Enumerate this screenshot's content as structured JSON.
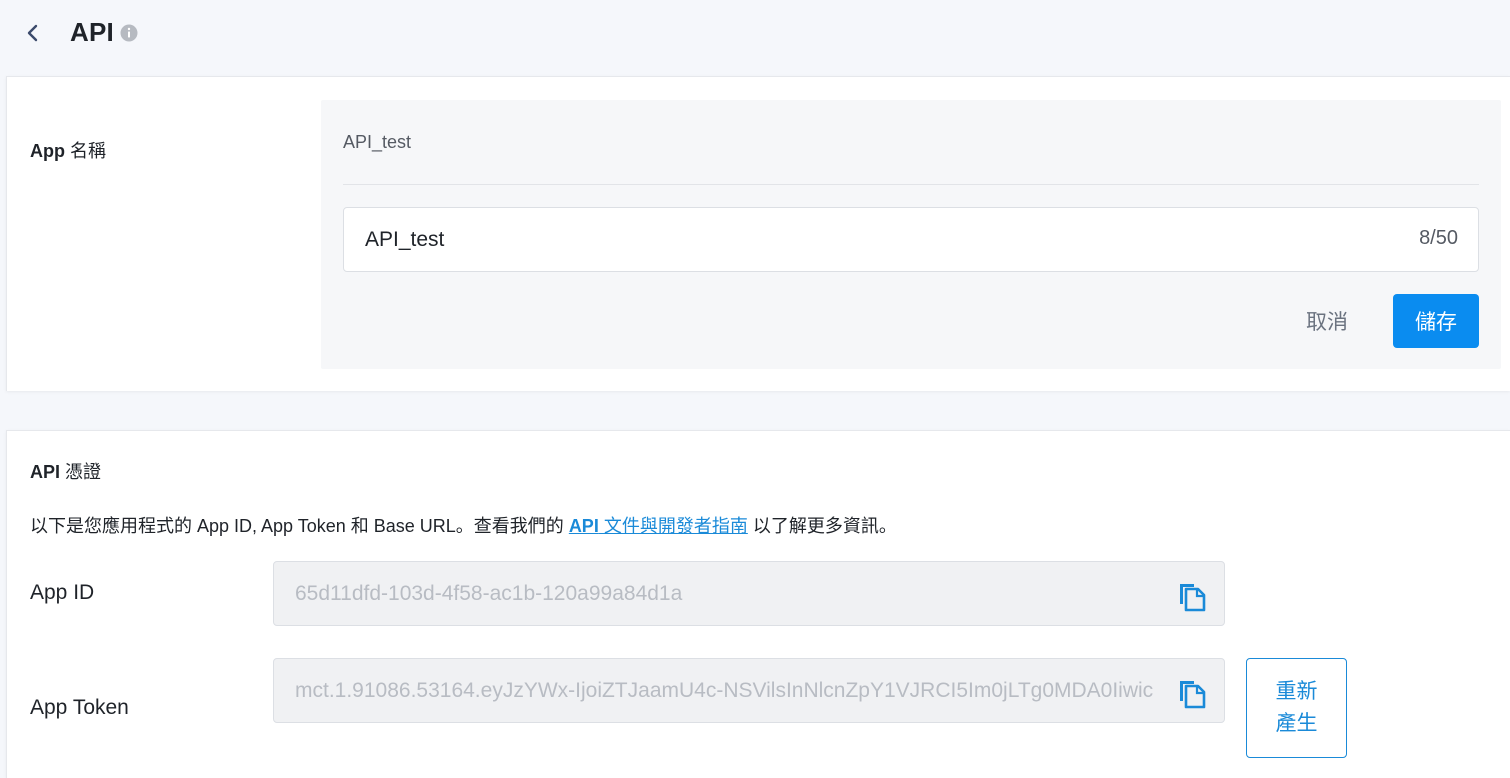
{
  "header": {
    "title": "API",
    "back_icon": "chevron-left-icon",
    "info_icon": "info-icon"
  },
  "app_name": {
    "label_prefix": "App",
    "label_suffix": "名稱",
    "current_value": "API_test",
    "input_value": "API_test",
    "char_count": "8/50",
    "cancel_label": "取消",
    "save_label": "儲存"
  },
  "credentials": {
    "title_prefix": "API",
    "title_suffix": "憑證",
    "desc_before": "以下是您應用程式的 App ID, App Token 和 Base URL。查看我們的 ",
    "link_prefix": "API",
    "link_suffix": " 文件與開發者指南",
    "desc_after": " 以了解更多資訊。",
    "app_id_label": "App ID",
    "app_id_value": "65d11dfd-103d-4f58-ac1b-120a99a84d1a",
    "app_token_label": "App Token",
    "app_token_value": "mct.1.91086.53164.eyJzYWx-IjoiZTJaamU4c-NSVilsInNlcnZpY1VJRCI5Im0jLTg0MDA0Iiwic",
    "regen_line1": "重新",
    "regen_line2": "產生"
  },
  "colors": {
    "accent": "#0a8cf0",
    "link": "#1a8ad8",
    "background": "#f5f7fb"
  }
}
